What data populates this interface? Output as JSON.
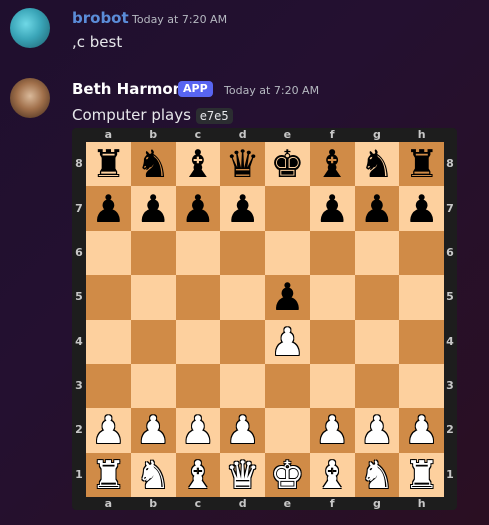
{
  "messages": [
    {
      "username": "brobot",
      "username_color": "#5b8dd9",
      "timestamp": "Today at 7:20 AM",
      "text": ",c best"
    },
    {
      "username": "Beth Harmon",
      "username_color": "#ffffff",
      "badge": "APP",
      "timestamp": "Today at 7:20 AM",
      "text_prefix": "Computer plays",
      "move": "e7e5"
    }
  ],
  "board": {
    "files": [
      "a",
      "b",
      "c",
      "d",
      "e",
      "f",
      "g",
      "h"
    ],
    "ranks": [
      "8",
      "7",
      "6",
      "5",
      "4",
      "3",
      "2",
      "1"
    ],
    "light_color": "#fdd09e",
    "dark_color": "#d08b47",
    "rows": [
      [
        "r",
        "n",
        "b",
        "q",
        "k",
        "b",
        "n",
        "r"
      ],
      [
        "p",
        "p",
        "p",
        "p",
        "",
        "p",
        "p",
        "p"
      ],
      [
        "",
        "",
        "",
        "",
        "",
        "",
        "",
        ""
      ],
      [
        "",
        "",
        "",
        "",
        "p",
        "",
        "",
        ""
      ],
      [
        "",
        "",
        "",
        "",
        "P",
        "",
        "",
        ""
      ],
      [
        "",
        "",
        "",
        "",
        "",
        "",
        "",
        ""
      ],
      [
        "P",
        "P",
        "P",
        "P",
        "",
        "P",
        "P",
        "P"
      ],
      [
        "R",
        "N",
        "B",
        "Q",
        "K",
        "B",
        "N",
        "R"
      ]
    ]
  }
}
